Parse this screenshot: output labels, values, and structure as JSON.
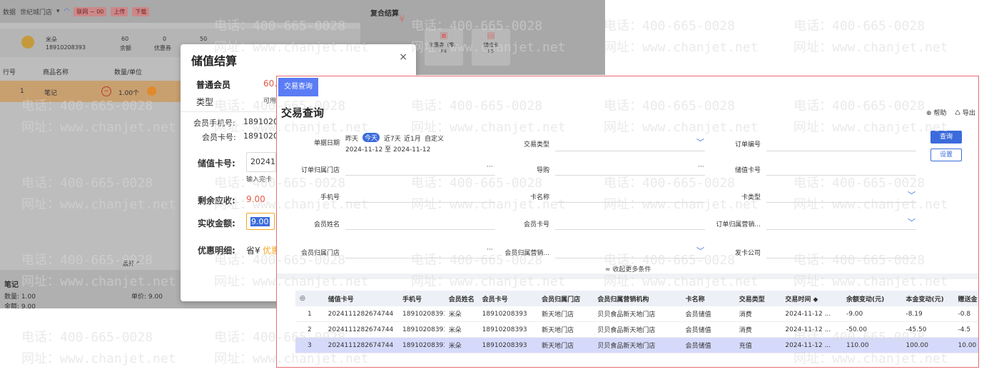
{
  "pos": {
    "store_prefix": "数据",
    "store_name": "世纪城门店",
    "chip_a": "联网 ~ 00",
    "chip_b": "上传",
    "chip_c": "下载",
    "member_name": "米朵",
    "member_phone": "18910208393",
    "stat1_value": "60",
    "stat1_label": "余额",
    "stat2_value": "0",
    "stat2_label": "优惠券",
    "stat3_value": "50",
    "col_line": "行号",
    "col_name": "商品名称",
    "col_qty": "数量/单位",
    "row_no": "1",
    "row_name": "笔记",
    "row_qty": "1.00个",
    "expand": "展开 ^",
    "item_name": "笔记",
    "item_qty": "数量: 1.00",
    "item_price": "单价: 9.00",
    "item_amount": "金额: 9.00"
  },
  "combo": {
    "title": "复合结算",
    "coupon_label": "优惠券（零...",
    "coupon_key": "F4",
    "card_label": "储值卡",
    "card_key": "F5"
  },
  "dialog": {
    "title": "储值结算",
    "close": "×",
    "member_type": "普通会员",
    "balance": "60.",
    "type_label": "类型",
    "type_value": "可用",
    "phone_label": "会员手机号:",
    "phone_value": "18910208",
    "card_label": "会员卡号:",
    "card_value": "18910208",
    "storecard_label": "储值卡号:",
    "storecard_value": "202411",
    "storecard_hint": "输入完卡",
    "remaining_label": "剩余应收:",
    "remaining_value": "9.00",
    "received_label": "实收金额:",
    "received_value": "9.00",
    "discount_label": "优惠明细:",
    "discount_prefix": "省¥",
    "discount_value": "优惠"
  },
  "query": {
    "tab_label": "交易查询 ×",
    "title": "交易查询",
    "help": "⊕ 帮助",
    "export": "♺ 导出",
    "date_label": "单据日期",
    "date_opts": [
      "昨天",
      "今天",
      "近7天",
      "近1月",
      "自定义"
    ],
    "date_range": "2024-11-12 至 2024-11-12",
    "txn_type_label": "交易类型",
    "order_no_label": "订单编号",
    "search_btn": "查询",
    "settings_btn": "设置",
    "order_store_label": "订单归属门店",
    "guide_label": "导购",
    "storecard_no_label": "储值卡号",
    "phone_label": "手机号",
    "card_name_label": "卡名称",
    "card_type_label": "卡类型",
    "member_name_label": "会员姓名",
    "member_card_label": "会员卡号",
    "order_org_label": "订单归属营销...",
    "member_store_label": "会员归属门店",
    "member_org_label": "会员归属营销...",
    "issuer_label": "发卡公司",
    "collapse": "≈ 收起更多条件",
    "columns": [
      "◎",
      "储值卡号",
      "手机号",
      "会员姓名",
      "会员卡号",
      "会员归属门店",
      "会员归属营销机构",
      "卡名称",
      "交易类型",
      "交易时间 ◆",
      "余额变动(元)",
      "本金变动(元)",
      "赠送金"
    ],
    "rows": [
      [
        "1",
        "2024111282674744",
        "18910208393",
        "米朵",
        "18910208393",
        "新天地门店",
        "贝贝食品新天地门店",
        "会员储值",
        "消费",
        "2024-11-12 ...",
        "-9.00",
        "-8.19",
        "-0.8"
      ],
      [
        "2",
        "2024111282674744",
        "18910208393",
        "米朵",
        "18910208393",
        "新天地门店",
        "贝贝食品新天地门店",
        "会员储值",
        "消费",
        "2024-11-12 ...",
        "-50.00",
        "-45.50",
        "-4.5"
      ],
      [
        "3",
        "2024111282674744",
        "18910208393",
        "米朵",
        "18910208393",
        "新天地门店",
        "贝贝食品新天地门店",
        "会员储值",
        "充值",
        "2024-11-12 ...",
        "110.00",
        "100.00",
        "10.00"
      ]
    ]
  },
  "watermark": {
    "phone": "电话：400-665-0028",
    "site": "网址：www.chanjet.net"
  },
  "colors": {
    "accent": "#5a7cf5",
    "highlight_row": "#d6dafa",
    "warn": "#f5a623",
    "border_red": "#e56b75"
  }
}
